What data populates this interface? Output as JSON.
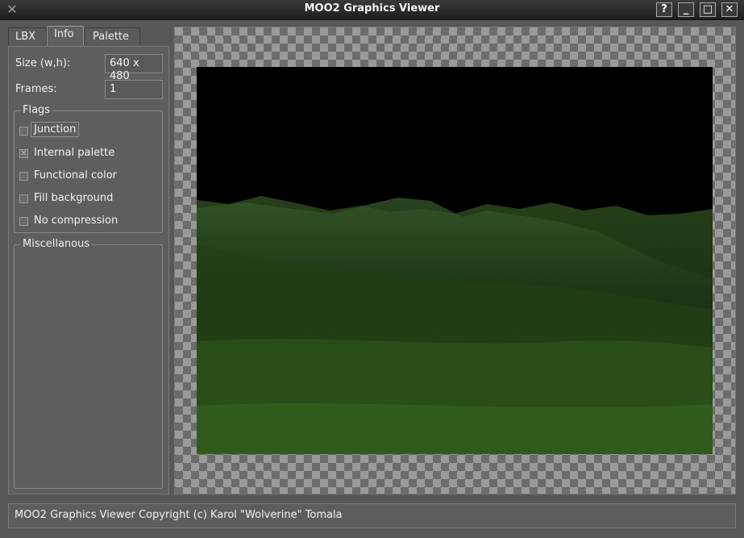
{
  "window": {
    "title": "MOO2 Graphics Viewer",
    "buttons": {
      "help": "?",
      "minimize": "_",
      "maximize": "□",
      "close": "✕"
    }
  },
  "tabs": [
    {
      "label": "LBX",
      "active": false
    },
    {
      "label": "Info",
      "active": true
    },
    {
      "label": "Palette",
      "active": false
    }
  ],
  "info": {
    "size_label": "Size (w,h):",
    "size_value": "640 x 480",
    "frames_label": "Frames:",
    "frames_value": "1"
  },
  "flags": {
    "title": "Flags",
    "items": [
      {
        "label": "Junction",
        "checked": false
      },
      {
        "label": "Internal palette",
        "checked": true
      },
      {
        "label": "Functional color",
        "checked": false
      },
      {
        "label": "Fill background",
        "checked": false
      },
      {
        "label": "No compression",
        "checked": false
      }
    ]
  },
  "misc": {
    "title": "Miscellanous"
  },
  "status": {
    "text": "MOO2 Graphics Viewer Copyright (c) Karol \"Wolverine\" Tomala"
  },
  "colors": {
    "background": "#555555",
    "titlebar": "#2a2a2a",
    "sky": "#000000",
    "terrain": "#2c4a1a"
  }
}
